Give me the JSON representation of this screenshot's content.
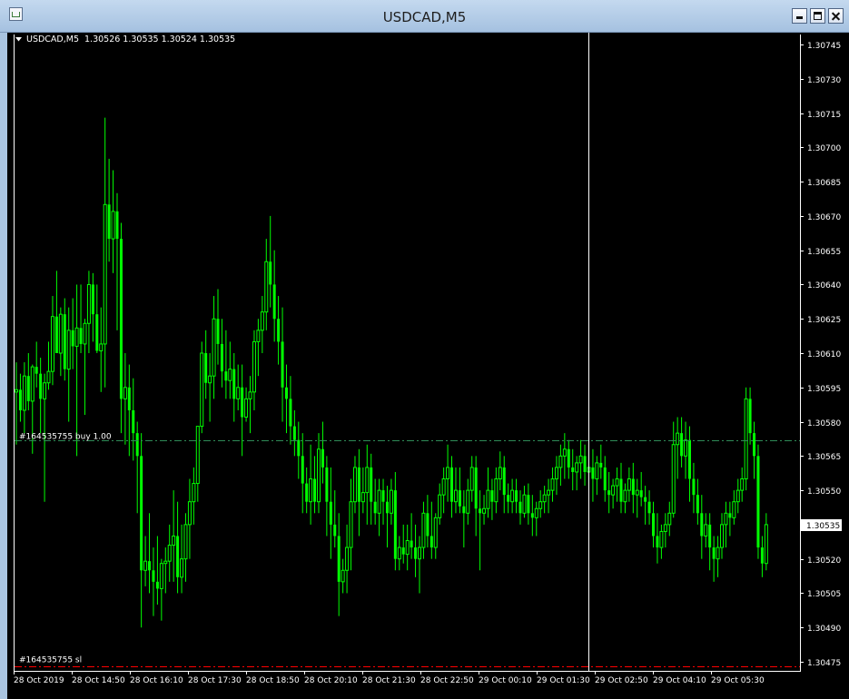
{
  "window": {
    "title": "USDCAD,M5"
  },
  "info": {
    "symbol_tf": "USDCAD,M5",
    "ohlc": "1.30526 1.30535 1.30524 1.30535"
  },
  "icons": {
    "window": "chart-window-icon",
    "minimize": "minimize-icon",
    "maximize": "maximize-icon",
    "close": "close-icon",
    "dropdown": "triangle-down-icon"
  },
  "chart_data": {
    "type": "candlestick",
    "colors": {
      "background": "#000000",
      "candle": "#00ff00",
      "grid_text": "#ffffff",
      "crosshair": "#ffffff",
      "buy_line": "#2e8b57",
      "sl_line": "#ff0000"
    },
    "y_ticks": [
      "1.30475",
      "1.30490",
      "1.30505",
      "1.30520",
      "1.30535",
      "1.30550",
      "1.30565",
      "1.30580",
      "1.30595",
      "1.30610",
      "1.30625",
      "1.30640",
      "1.30655",
      "1.30670",
      "1.30685",
      "1.30700",
      "1.30715",
      "1.30730",
      "1.30745"
    ],
    "ylim": [
      1.3047,
      1.3075
    ],
    "x_labels": [
      "28 Oct 2019",
      "28 Oct 14:50",
      "28 Oct 16:10",
      "28 Oct 17:30",
      "28 Oct 18:50",
      "28 Oct 20:10",
      "28 Oct 21:30",
      "28 Oct 22:50",
      "29 Oct 00:10",
      "29 Oct 01:30",
      "29 Oct 02:50",
      "29 Oct 04:10",
      "29 Oct 05:30"
    ],
    "current_price": "1.30535",
    "orders": [
      {
        "label": "#164535755 buy 1.00",
        "price": 1.30572,
        "style": "dash-dot"
      },
      {
        "label": "#164535755 sl",
        "price": 1.30473,
        "style": "dash-dot"
      }
    ],
    "crosshair_index": 142,
    "candles": [
      [
        1.30593,
        1.30606,
        1.3057,
        1.30594
      ],
      [
        1.30594,
        1.30601,
        1.3058,
        1.30585
      ],
      [
        1.30585,
        1.30606,
        1.30575,
        1.306
      ],
      [
        1.306,
        1.3061,
        1.30585,
        1.30589
      ],
      [
        1.30589,
        1.30605,
        1.30566,
        1.30604
      ],
      [
        1.30604,
        1.30615,
        1.30595,
        1.30601
      ],
      [
        1.30601,
        1.30608,
        1.30575,
        1.3059
      ],
      [
        1.3059,
        1.30601,
        1.30545,
        1.30597
      ],
      [
        1.30597,
        1.30615,
        1.30594,
        1.30602
      ],
      [
        1.30602,
        1.30635,
        1.30596,
        1.30626
      ],
      [
        1.30626,
        1.30646,
        1.3061,
        1.3061
      ],
      [
        1.3061,
        1.3063,
        1.306,
        1.30627
      ],
      [
        1.30627,
        1.30634,
        1.30598,
        1.30603
      ],
      [
        1.30603,
        1.3063,
        1.3058,
        1.3062
      ],
      [
        1.3062,
        1.30634,
        1.30603,
        1.30613
      ],
      [
        1.30613,
        1.3064,
        1.30565,
        1.30621
      ],
      [
        1.30621,
        1.3064,
        1.3061,
        1.30614
      ],
      [
        1.30614,
        1.30625,
        1.30583,
        1.30623
      ],
      [
        1.30623,
        1.30646,
        1.3061,
        1.3064
      ],
      [
        1.3064,
        1.30645,
        1.30615,
        1.30627
      ],
      [
        1.30627,
        1.3064,
        1.3061,
        1.30611
      ],
      [
        1.30611,
        1.3063,
        1.30593,
        1.30614
      ],
      [
        1.30614,
        1.30713,
        1.30595,
        1.30675
      ],
      [
        1.30675,
        1.30695,
        1.3065,
        1.3066
      ],
      [
        1.3066,
        1.3069,
        1.30645,
        1.30672
      ],
      [
        1.30672,
        1.3068,
        1.3062,
        1.3066
      ],
      [
        1.3066,
        1.30667,
        1.30575,
        1.3059
      ],
      [
        1.3059,
        1.3061,
        1.3057,
        1.30595
      ],
      [
        1.30595,
        1.30605,
        1.30565,
        1.30585
      ],
      [
        1.30585,
        1.30599,
        1.30563,
        1.30575
      ],
      [
        1.30575,
        1.3058,
        1.3054,
        1.30565
      ],
      [
        1.30565,
        1.30575,
        1.3049,
        1.30515
      ],
      [
        1.30515,
        1.3053,
        1.30508,
        1.30519
      ],
      [
        1.30519,
        1.3054,
        1.30505,
        1.30515
      ],
      [
        1.30515,
        1.30525,
        1.30495,
        1.3051
      ],
      [
        1.3051,
        1.3053,
        1.305,
        1.30507
      ],
      [
        1.30507,
        1.3052,
        1.30493,
        1.30518
      ],
      [
        1.30518,
        1.30525,
        1.30505,
        1.30519
      ],
      [
        1.30519,
        1.30535,
        1.3051,
        1.30526
      ],
      [
        1.30526,
        1.3055,
        1.3051,
        1.3053
      ],
      [
        1.3053,
        1.30545,
        1.30505,
        1.30512
      ],
      [
        1.30512,
        1.30535,
        1.30505,
        1.3052
      ],
      [
        1.3052,
        1.3054,
        1.3051,
        1.30535
      ],
      [
        1.30535,
        1.30555,
        1.3052,
        1.30545
      ],
      [
        1.30545,
        1.3056,
        1.30535,
        1.30553
      ],
      [
        1.30553,
        1.3057,
        1.30545,
        1.30578
      ],
      [
        1.30578,
        1.30615,
        1.30575,
        1.3061
      ],
      [
        1.3061,
        1.3062,
        1.3059,
        1.30597
      ],
      [
        1.30597,
        1.3061,
        1.3058,
        1.306
      ],
      [
        1.306,
        1.30635,
        1.3059,
        1.30625
      ],
      [
        1.30625,
        1.30638,
        1.30605,
        1.30614
      ],
      [
        1.30614,
        1.30625,
        1.30595,
        1.30602
      ],
      [
        1.30602,
        1.3062,
        1.3059,
        1.30598
      ],
      [
        1.30598,
        1.30615,
        1.3059,
        1.30603
      ],
      [
        1.30603,
        1.3061,
        1.3058,
        1.3059
      ],
      [
        1.3059,
        1.30605,
        1.30585,
        1.30595
      ],
      [
        1.30595,
        1.30605,
        1.30565,
        1.30582
      ],
      [
        1.30582,
        1.30595,
        1.3058,
        1.3059
      ],
      [
        1.3059,
        1.306,
        1.30575,
        1.30593
      ],
      [
        1.30593,
        1.3062,
        1.30585,
        1.30615
      ],
      [
        1.30615,
        1.30625,
        1.306,
        1.3062
      ],
      [
        1.3062,
        1.30635,
        1.3061,
        1.30628
      ],
      [
        1.30628,
        1.3066,
        1.3062,
        1.3065
      ],
      [
        1.3065,
        1.3067,
        1.3063,
        1.3064
      ],
      [
        1.3064,
        1.30655,
        1.30615,
        1.30625
      ],
      [
        1.30625,
        1.30635,
        1.30605,
        1.30615
      ],
      [
        1.30615,
        1.3063,
        1.3058,
        1.30595
      ],
      [
        1.30595,
        1.30605,
        1.30575,
        1.3059
      ],
      [
        1.3059,
        1.306,
        1.3057,
        1.30578
      ],
      [
        1.30578,
        1.30585,
        1.30565,
        1.30572
      ],
      [
        1.30572,
        1.3058,
        1.30555,
        1.30565
      ],
      [
        1.30565,
        1.30575,
        1.3054,
        1.30553
      ],
      [
        1.30553,
        1.3056,
        1.3054,
        1.30545
      ],
      [
        1.30545,
        1.3057,
        1.30535,
        1.30555
      ],
      [
        1.30555,
        1.30565,
        1.3054,
        1.30545
      ],
      [
        1.30545,
        1.30575,
        1.3054,
        1.30568
      ],
      [
        1.30568,
        1.3058,
        1.30553,
        1.3056
      ],
      [
        1.3056,
        1.30565,
        1.3053,
        1.30545
      ],
      [
        1.30545,
        1.3056,
        1.3052,
        1.30535
      ],
      [
        1.30535,
        1.3055,
        1.30525,
        1.3053
      ],
      [
        1.3053,
        1.3054,
        1.30495,
        1.3051
      ],
      [
        1.3051,
        1.3052,
        1.30505,
        1.30515
      ],
      [
        1.30515,
        1.30535,
        1.30505,
        1.30525
      ],
      [
        1.30525,
        1.30555,
        1.30515,
        1.30545
      ],
      [
        1.30545,
        1.30565,
        1.3054,
        1.3056
      ],
      [
        1.3056,
        1.30568,
        1.3053,
        1.30545
      ],
      [
        1.30545,
        1.3056,
        1.3054,
        1.30549
      ],
      [
        1.30549,
        1.3057,
        1.30535,
        1.3056
      ],
      [
        1.3056,
        1.30566,
        1.30535,
        1.30545
      ],
      [
        1.30545,
        1.30555,
        1.30535,
        1.3054
      ],
      [
        1.3054,
        1.30555,
        1.3053,
        1.3055
      ],
      [
        1.3055,
        1.30555,
        1.30535,
        1.30545
      ],
      [
        1.30545,
        1.30552,
        1.30525,
        1.3054
      ],
      [
        1.3054,
        1.30555,
        1.30535,
        1.3055
      ],
      [
        1.3055,
        1.30558,
        1.30515,
        1.3052
      ],
      [
        1.3052,
        1.3053,
        1.30515,
        1.30525
      ],
      [
        1.30525,
        1.30535,
        1.30518,
        1.30522
      ],
      [
        1.30522,
        1.30535,
        1.30515,
        1.30528
      ],
      [
        1.30528,
        1.3054,
        1.3052,
        1.30525
      ],
      [
        1.30525,
        1.30535,
        1.30512,
        1.3052
      ],
      [
        1.3052,
        1.3053,
        1.30505,
        1.30525
      ],
      [
        1.30525,
        1.30545,
        1.3052,
        1.3054
      ],
      [
        1.3054,
        1.30548,
        1.30525,
        1.3053
      ],
      [
        1.3053,
        1.30545,
        1.3052,
        1.30525
      ],
      [
        1.30525,
        1.3054,
        1.3052,
        1.30538
      ],
      [
        1.30538,
        1.30553,
        1.30535,
        1.30548
      ],
      [
        1.30548,
        1.3056,
        1.3054,
        1.30555
      ],
      [
        1.30555,
        1.3057,
        1.30545,
        1.3056
      ],
      [
        1.3056,
        1.30565,
        1.30538,
        1.30545
      ],
      [
        1.30545,
        1.3056,
        1.3054,
        1.3055
      ],
      [
        1.3055,
        1.3056,
        1.3054,
        1.30543
      ],
      [
        1.30543,
        1.3055,
        1.30525,
        1.3054
      ],
      [
        1.3054,
        1.30555,
        1.30535,
        1.3055
      ],
      [
        1.3055,
        1.30565,
        1.30545,
        1.3056
      ],
      [
        1.3056,
        1.30565,
        1.3053,
        1.30542
      ],
      [
        1.30542,
        1.3055,
        1.30515,
        1.3054
      ],
      [
        1.3054,
        1.30548,
        1.30535,
        1.30542
      ],
      [
        1.30542,
        1.3056,
        1.30538,
        1.3055
      ],
      [
        1.3055,
        1.30555,
        1.30537,
        1.30545
      ],
      [
        1.30545,
        1.3056,
        1.3054,
        1.30555
      ],
      [
        1.30555,
        1.30567,
        1.3055,
        1.3056
      ],
      [
        1.3056,
        1.30565,
        1.3054,
        1.30548
      ],
      [
        1.30548,
        1.30553,
        1.3054,
        1.30545
      ],
      [
        1.30545,
        1.30555,
        1.3054,
        1.3055
      ],
      [
        1.3055,
        1.30555,
        1.3054,
        1.30545
      ],
      [
        1.30545,
        1.3055,
        1.30535,
        1.3054
      ],
      [
        1.3054,
        1.30552,
        1.30538,
        1.30548
      ],
      [
        1.30548,
        1.30553,
        1.30535,
        1.3054
      ],
      [
        1.3054,
        1.30548,
        1.3053,
        1.30538
      ],
      [
        1.30538,
        1.30545,
        1.3053,
        1.30542
      ],
      [
        1.30542,
        1.3055,
        1.30538,
        1.30545
      ],
      [
        1.30545,
        1.30552,
        1.3054,
        1.30548
      ],
      [
        1.30548,
        1.30555,
        1.3054,
        1.3055
      ],
      [
        1.3055,
        1.3056,
        1.30545,
        1.30555
      ],
      [
        1.30555,
        1.30565,
        1.30548,
        1.3056
      ],
      [
        1.3056,
        1.3057,
        1.30552,
        1.30565
      ],
      [
        1.30565,
        1.30575,
        1.30555,
        1.30568
      ],
      [
        1.30568,
        1.30572,
        1.30555,
        1.3056
      ],
      [
        1.3056,
        1.30568,
        1.3055,
        1.30558
      ],
      [
        1.30558,
        1.30565,
        1.3055,
        1.30562
      ],
      [
        1.30562,
        1.30572,
        1.30555,
        1.30565
      ],
      [
        1.30565,
        1.3057,
        1.30552,
        1.30558
      ],
      [
        1.30558,
        1.30566,
        1.3055,
        1.3056
      ],
      [
        1.3056,
        1.30568,
        1.30545,
        1.30555
      ],
      [
        1.30555,
        1.30565,
        1.30548,
        1.30562
      ],
      [
        1.30562,
        1.3057,
        1.30555,
        1.3056
      ],
      [
        1.3056,
        1.30565,
        1.30545,
        1.3055
      ],
      [
        1.3055,
        1.30558,
        1.3054,
        1.30548
      ],
      [
        1.30548,
        1.30555,
        1.30542,
        1.30552
      ],
      [
        1.30552,
        1.3056,
        1.30545,
        1.30555
      ],
      [
        1.30555,
        1.30562,
        1.3054,
        1.30545
      ],
      [
        1.30545,
        1.30553,
        1.3054,
        1.3055
      ],
      [
        1.3055,
        1.3056,
        1.30545,
        1.30555
      ],
      [
        1.30555,
        1.30562,
        1.3054,
        1.30548
      ],
      [
        1.30548,
        1.30555,
        1.30538,
        1.3055
      ],
      [
        1.3055,
        1.30558,
        1.30543,
        1.30547
      ],
      [
        1.30547,
        1.30552,
        1.30535,
        1.30545
      ],
      [
        1.30545,
        1.3055,
        1.30535,
        1.3054
      ],
      [
        1.3054,
        1.30545,
        1.30525,
        1.3053
      ],
      [
        1.3053,
        1.3054,
        1.30518,
        1.30525
      ],
      [
        1.30525,
        1.30535,
        1.3052,
        1.30532
      ],
      [
        1.30532,
        1.3054,
        1.30525,
        1.30535
      ],
      [
        1.30535,
        1.30545,
        1.3053,
        1.3054
      ],
      [
        1.3054,
        1.3058,
        1.30538,
        1.3057
      ],
      [
        1.3057,
        1.30582,
        1.30555,
        1.30575
      ],
      [
        1.30575,
        1.30582,
        1.3056,
        1.30565
      ],
      [
        1.30565,
        1.3058,
        1.30555,
        1.30572
      ],
      [
        1.30572,
        1.30578,
        1.30545,
        1.30555
      ],
      [
        1.30555,
        1.30562,
        1.3054,
        1.30548
      ],
      [
        1.30548,
        1.30555,
        1.30535,
        1.3054
      ],
      [
        1.3054,
        1.30548,
        1.3052,
        1.3053
      ],
      [
        1.3053,
        1.3054,
        1.30525,
        1.30535
      ],
      [
        1.30535,
        1.3054,
        1.30515,
        1.30525
      ],
      [
        1.30525,
        1.3053,
        1.3051,
        1.3052
      ],
      [
        1.3052,
        1.3053,
        1.30512,
        1.30525
      ],
      [
        1.30525,
        1.3054,
        1.3052,
        1.30535
      ],
      [
        1.30535,
        1.30545,
        1.30525,
        1.3054
      ],
      [
        1.3054,
        1.30545,
        1.3053,
        1.30538
      ],
      [
        1.30538,
        1.3055,
        1.30535,
        1.30545
      ],
      [
        1.30545,
        1.30555,
        1.3054,
        1.3055
      ],
      [
        1.3055,
        1.3056,
        1.30545,
        1.30555
      ],
      [
        1.30555,
        1.30595,
        1.3055,
        1.3059
      ],
      [
        1.3059,
        1.30595,
        1.3057,
        1.30575
      ],
      [
        1.30575,
        1.3058,
        1.30555,
        1.30565
      ],
      [
        1.30565,
        1.3057,
        1.3052,
        1.30525
      ],
      [
        1.30525,
        1.3053,
        1.30512,
        1.30518
      ],
      [
        1.30518,
        1.3054,
        1.30515,
        1.30535
      ]
    ]
  }
}
